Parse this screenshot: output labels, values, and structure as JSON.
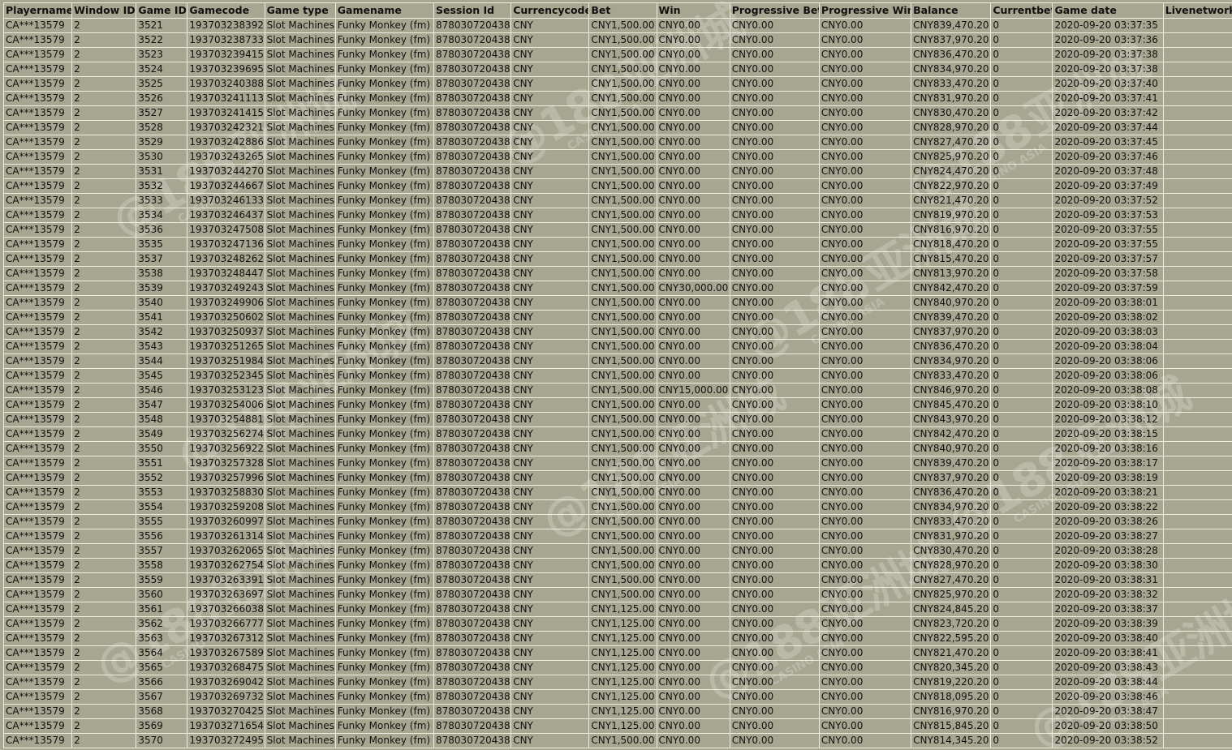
{
  "columns": [
    "Playername",
    "Window ID",
    "Game ID",
    "Gamecode",
    "Game type",
    "Gamename",
    "Session Id",
    "Currencycode",
    "Bet",
    "Win",
    "Progressive Bet",
    "Progressive Win",
    "Balance",
    "Currentbet",
    "Game date",
    "Livenetwork"
  ],
  "rows": [
    [
      "CA***13579",
      "2",
      "3521",
      "193703238392",
      "Slot Machines",
      "Funky Monkey (fm)",
      "878030720438",
      "CNY",
      "CNY1,500.00",
      "CNY0.00",
      "CNY0.00",
      "CNY0.00",
      "CNY839,470.20",
      "0",
      "2020-09-20 03:37:35",
      ""
    ],
    [
      "CA***13579",
      "2",
      "3522",
      "193703238733",
      "Slot Machines",
      "Funky Monkey (fm)",
      "878030720438",
      "CNY",
      "CNY1,500.00",
      "CNY0.00",
      "CNY0.00",
      "CNY0.00",
      "CNY837,970.20",
      "0",
      "2020-09-20 03:37:36",
      ""
    ],
    [
      "CA***13579",
      "2",
      "3523",
      "193703239415",
      "Slot Machines",
      "Funky Monkey (fm)",
      "878030720438",
      "CNY",
      "CNY1,500.00",
      "CNY0.00",
      "CNY0.00",
      "CNY0.00",
      "CNY836,470.20",
      "0",
      "2020-09-20 03:37:38",
      ""
    ],
    [
      "CA***13579",
      "2",
      "3524",
      "193703239695",
      "Slot Machines",
      "Funky Monkey (fm)",
      "878030720438",
      "CNY",
      "CNY1,500.00",
      "CNY0.00",
      "CNY0.00",
      "CNY0.00",
      "CNY834,970.20",
      "0",
      "2020-09-20 03:37:38",
      ""
    ],
    [
      "CA***13579",
      "2",
      "3525",
      "193703240388",
      "Slot Machines",
      "Funky Monkey (fm)",
      "878030720438",
      "CNY",
      "CNY1,500.00",
      "CNY0.00",
      "CNY0.00",
      "CNY0.00",
      "CNY833,470.20",
      "0",
      "2020-09-20 03:37:40",
      ""
    ],
    [
      "CA***13579",
      "2",
      "3526",
      "193703241113",
      "Slot Machines",
      "Funky Monkey (fm)",
      "878030720438",
      "CNY",
      "CNY1,500.00",
      "CNY0.00",
      "CNY0.00",
      "CNY0.00",
      "CNY831,970.20",
      "0",
      "2020-09-20 03:37:41",
      ""
    ],
    [
      "CA***13579",
      "2",
      "3527",
      "193703241415",
      "Slot Machines",
      "Funky Monkey (fm)",
      "878030720438",
      "CNY",
      "CNY1,500.00",
      "CNY0.00",
      "CNY0.00",
      "CNY0.00",
      "CNY830,470.20",
      "0",
      "2020-09-20 03:37:42",
      ""
    ],
    [
      "CA***13579",
      "2",
      "3528",
      "193703242321",
      "Slot Machines",
      "Funky Monkey (fm)",
      "878030720438",
      "CNY",
      "CNY1,500.00",
      "CNY0.00",
      "CNY0.00",
      "CNY0.00",
      "CNY828,970.20",
      "0",
      "2020-09-20 03:37:44",
      ""
    ],
    [
      "CA***13579",
      "2",
      "3529",
      "193703242886",
      "Slot Machines",
      "Funky Monkey (fm)",
      "878030720438",
      "CNY",
      "CNY1,500.00",
      "CNY0.00",
      "CNY0.00",
      "CNY0.00",
      "CNY827,470.20",
      "0",
      "2020-09-20 03:37:45",
      ""
    ],
    [
      "CA***13579",
      "2",
      "3530",
      "193703243265",
      "Slot Machines",
      "Funky Monkey (fm)",
      "878030720438",
      "CNY",
      "CNY1,500.00",
      "CNY0.00",
      "CNY0.00",
      "CNY0.00",
      "CNY825,970.20",
      "0",
      "2020-09-20 03:37:46",
      ""
    ],
    [
      "CA***13579",
      "2",
      "3531",
      "193703244270",
      "Slot Machines",
      "Funky Monkey (fm)",
      "878030720438",
      "CNY",
      "CNY1,500.00",
      "CNY0.00",
      "CNY0.00",
      "CNY0.00",
      "CNY824,470.20",
      "0",
      "2020-09-20 03:37:48",
      ""
    ],
    [
      "CA***13579",
      "2",
      "3532",
      "193703244667",
      "Slot Machines",
      "Funky Monkey (fm)",
      "878030720438",
      "CNY",
      "CNY1,500.00",
      "CNY0.00",
      "CNY0.00",
      "CNY0.00",
      "CNY822,970.20",
      "0",
      "2020-09-20 03:37:49",
      ""
    ],
    [
      "CA***13579",
      "2",
      "3533",
      "193703246133",
      "Slot Machines",
      "Funky Monkey (fm)",
      "878030720438",
      "CNY",
      "CNY1,500.00",
      "CNY0.00",
      "CNY0.00",
      "CNY0.00",
      "CNY821,470.20",
      "0",
      "2020-09-20 03:37:52",
      ""
    ],
    [
      "CA***13579",
      "2",
      "3534",
      "193703246437",
      "Slot Machines",
      "Funky Monkey (fm)",
      "878030720438",
      "CNY",
      "CNY1,500.00",
      "CNY0.00",
      "CNY0.00",
      "CNY0.00",
      "CNY819,970.20",
      "0",
      "2020-09-20 03:37:53",
      ""
    ],
    [
      "CA***13579",
      "2",
      "3536",
      "193703247508",
      "Slot Machines",
      "Funky Monkey (fm)",
      "878030720438",
      "CNY",
      "CNY1,500.00",
      "CNY0.00",
      "CNY0.00",
      "CNY0.00",
      "CNY816,970.20",
      "0",
      "2020-09-20 03:37:55",
      ""
    ],
    [
      "CA***13579",
      "2",
      "3535",
      "193703247136",
      "Slot Machines",
      "Funky Monkey (fm)",
      "878030720438",
      "CNY",
      "CNY1,500.00",
      "CNY0.00",
      "CNY0.00",
      "CNY0.00",
      "CNY818,470.20",
      "0",
      "2020-09-20 03:37:55",
      ""
    ],
    [
      "CA***13579",
      "2",
      "3537",
      "193703248262",
      "Slot Machines",
      "Funky Monkey (fm)",
      "878030720438",
      "CNY",
      "CNY1,500.00",
      "CNY0.00",
      "CNY0.00",
      "CNY0.00",
      "CNY815,470.20",
      "0",
      "2020-09-20 03:37:57",
      ""
    ],
    [
      "CA***13579",
      "2",
      "3538",
      "193703248447",
      "Slot Machines",
      "Funky Monkey (fm)",
      "878030720438",
      "CNY",
      "CNY1,500.00",
      "CNY0.00",
      "CNY0.00",
      "CNY0.00",
      "CNY813,970.20",
      "0",
      "2020-09-20 03:37:58",
      ""
    ],
    [
      "CA***13579",
      "2",
      "3539",
      "193703249243",
      "Slot Machines",
      "Funky Monkey (fm)",
      "878030720438",
      "CNY",
      "CNY1,500.00",
      "CNY30,000.00",
      "CNY0.00",
      "CNY0.00",
      "CNY842,470.20",
      "0",
      "2020-09-20 03:37:59",
      ""
    ],
    [
      "CA***13579",
      "2",
      "3540",
      "193703249906",
      "Slot Machines",
      "Funky Monkey (fm)",
      "878030720438",
      "CNY",
      "CNY1,500.00",
      "CNY0.00",
      "CNY0.00",
      "CNY0.00",
      "CNY840,970.20",
      "0",
      "2020-09-20 03:38:01",
      ""
    ],
    [
      "CA***13579",
      "2",
      "3541",
      "193703250602",
      "Slot Machines",
      "Funky Monkey (fm)",
      "878030720438",
      "CNY",
      "CNY1,500.00",
      "CNY0.00",
      "CNY0.00",
      "CNY0.00",
      "CNY839,470.20",
      "0",
      "2020-09-20 03:38:02",
      ""
    ],
    [
      "CA***13579",
      "2",
      "3542",
      "193703250937",
      "Slot Machines",
      "Funky Monkey (fm)",
      "878030720438",
      "CNY",
      "CNY1,500.00",
      "CNY0.00",
      "CNY0.00",
      "CNY0.00",
      "CNY837,970.20",
      "0",
      "2020-09-20 03:38:03",
      ""
    ],
    [
      "CA***13579",
      "2",
      "3543",
      "193703251265",
      "Slot Machines",
      "Funky Monkey (fm)",
      "878030720438",
      "CNY",
      "CNY1,500.00",
      "CNY0.00",
      "CNY0.00",
      "CNY0.00",
      "CNY836,470.20",
      "0",
      "2020-09-20 03:38:04",
      ""
    ],
    [
      "CA***13579",
      "2",
      "3544",
      "193703251984",
      "Slot Machines",
      "Funky Monkey (fm)",
      "878030720438",
      "CNY",
      "CNY1,500.00",
      "CNY0.00",
      "CNY0.00",
      "CNY0.00",
      "CNY834,970.20",
      "0",
      "2020-09-20 03:38:06",
      ""
    ],
    [
      "CA***13579",
      "2",
      "3545",
      "193703252345",
      "Slot Machines",
      "Funky Monkey (fm)",
      "878030720438",
      "CNY",
      "CNY1,500.00",
      "CNY0.00",
      "CNY0.00",
      "CNY0.00",
      "CNY833,470.20",
      "0",
      "2020-09-20 03:38:06",
      ""
    ],
    [
      "CA***13579",
      "2",
      "3546",
      "193703253123",
      "Slot Machines",
      "Funky Monkey (fm)",
      "878030720438",
      "CNY",
      "CNY1,500.00",
      "CNY15,000.00",
      "CNY0.00",
      "CNY0.00",
      "CNY846,970.20",
      "0",
      "2020-09-20 03:38:08",
      ""
    ],
    [
      "CA***13579",
      "2",
      "3547",
      "193703254006",
      "Slot Machines",
      "Funky Monkey (fm)",
      "878030720438",
      "CNY",
      "CNY1,500.00",
      "CNY0.00",
      "CNY0.00",
      "CNY0.00",
      "CNY845,470.20",
      "0",
      "2020-09-20 03:38:10",
      ""
    ],
    [
      "CA***13579",
      "2",
      "3548",
      "193703254881",
      "Slot Machines",
      "Funky Monkey (fm)",
      "878030720438",
      "CNY",
      "CNY1,500.00",
      "CNY0.00",
      "CNY0.00",
      "CNY0.00",
      "CNY843,970.20",
      "0",
      "2020-09-20 03:38:12",
      ""
    ],
    [
      "CA***13579",
      "2",
      "3549",
      "193703256274",
      "Slot Machines",
      "Funky Monkey (fm)",
      "878030720438",
      "CNY",
      "CNY1,500.00",
      "CNY0.00",
      "CNY0.00",
      "CNY0.00",
      "CNY842,470.20",
      "0",
      "2020-09-20 03:38:15",
      ""
    ],
    [
      "CA***13579",
      "2",
      "3550",
      "193703256922",
      "Slot Machines",
      "Funky Monkey (fm)",
      "878030720438",
      "CNY",
      "CNY1,500.00",
      "CNY0.00",
      "CNY0.00",
      "CNY0.00",
      "CNY840,970.20",
      "0",
      "2020-09-20 03:38:16",
      ""
    ],
    [
      "CA***13579",
      "2",
      "3551",
      "193703257328",
      "Slot Machines",
      "Funky Monkey (fm)",
      "878030720438",
      "CNY",
      "CNY1,500.00",
      "CNY0.00",
      "CNY0.00",
      "CNY0.00",
      "CNY839,470.20",
      "0",
      "2020-09-20 03:38:17",
      ""
    ],
    [
      "CA***13579",
      "2",
      "3552",
      "193703257996",
      "Slot Machines",
      "Funky Monkey (fm)",
      "878030720438",
      "CNY",
      "CNY1,500.00",
      "CNY0.00",
      "CNY0.00",
      "CNY0.00",
      "CNY837,970.20",
      "0",
      "2020-09-20 03:38:19",
      ""
    ],
    [
      "CA***13579",
      "2",
      "3553",
      "193703258830",
      "Slot Machines",
      "Funky Monkey (fm)",
      "878030720438",
      "CNY",
      "CNY1,500.00",
      "CNY0.00",
      "CNY0.00",
      "CNY0.00",
      "CNY836,470.20",
      "0",
      "2020-09-20 03:38:21",
      ""
    ],
    [
      "CA***13579",
      "2",
      "3554",
      "193703259208",
      "Slot Machines",
      "Funky Monkey (fm)",
      "878030720438",
      "CNY",
      "CNY1,500.00",
      "CNY0.00",
      "CNY0.00",
      "CNY0.00",
      "CNY834,970.20",
      "0",
      "2020-09-20 03:38:22",
      ""
    ],
    [
      "CA***13579",
      "2",
      "3555",
      "193703260997",
      "Slot Machines",
      "Funky Monkey (fm)",
      "878030720438",
      "CNY",
      "CNY1,500.00",
      "CNY0.00",
      "CNY0.00",
      "CNY0.00",
      "CNY833,470.20",
      "0",
      "2020-09-20 03:38:26",
      ""
    ],
    [
      "CA***13579",
      "2",
      "3556",
      "193703261314",
      "Slot Machines",
      "Funky Monkey (fm)",
      "878030720438",
      "CNY",
      "CNY1,500.00",
      "CNY0.00",
      "CNY0.00",
      "CNY0.00",
      "CNY831,970.20",
      "0",
      "2020-09-20 03:38:27",
      ""
    ],
    [
      "CA***13579",
      "2",
      "3557",
      "193703262065",
      "Slot Machines",
      "Funky Monkey (fm)",
      "878030720438",
      "CNY",
      "CNY1,500.00",
      "CNY0.00",
      "CNY0.00",
      "CNY0.00",
      "CNY830,470.20",
      "0",
      "2020-09-20 03:38:28",
      ""
    ],
    [
      "CA***13579",
      "2",
      "3558",
      "193703262754",
      "Slot Machines",
      "Funky Monkey (fm)",
      "878030720438",
      "CNY",
      "CNY1,500.00",
      "CNY0.00",
      "CNY0.00",
      "CNY0.00",
      "CNY828,970.20",
      "0",
      "2020-09-20 03:38:30",
      ""
    ],
    [
      "CA***13579",
      "2",
      "3559",
      "193703263391",
      "Slot Machines",
      "Funky Monkey (fm)",
      "878030720438",
      "CNY",
      "CNY1,500.00",
      "CNY0.00",
      "CNY0.00",
      "CNY0.00",
      "CNY827,470.20",
      "0",
      "2020-09-20 03:38:31",
      ""
    ],
    [
      "CA***13579",
      "2",
      "3560",
      "193703263697",
      "Slot Machines",
      "Funky Monkey (fm)",
      "878030720438",
      "CNY",
      "CNY1,500.00",
      "CNY0.00",
      "CNY0.00",
      "CNY0.00",
      "CNY825,970.20",
      "0",
      "2020-09-20 03:38:32",
      ""
    ],
    [
      "CA***13579",
      "2",
      "3561",
      "193703266038",
      "Slot Machines",
      "Funky Monkey (fm)",
      "878030720438",
      "CNY",
      "CNY1,125.00",
      "CNY0.00",
      "CNY0.00",
      "CNY0.00",
      "CNY824,845.20",
      "0",
      "2020-09-20 03:38:37",
      ""
    ],
    [
      "CA***13579",
      "2",
      "3562",
      "193703266777",
      "Slot Machines",
      "Funky Monkey (fm)",
      "878030720438",
      "CNY",
      "CNY1,125.00",
      "CNY0.00",
      "CNY0.00",
      "CNY0.00",
      "CNY823,720.20",
      "0",
      "2020-09-20 03:38:39",
      ""
    ],
    [
      "CA***13579",
      "2",
      "3563",
      "193703267312",
      "Slot Machines",
      "Funky Monkey (fm)",
      "878030720438",
      "CNY",
      "CNY1,125.00",
      "CNY0.00",
      "CNY0.00",
      "CNY0.00",
      "CNY822,595.20",
      "0",
      "2020-09-20 03:38:40",
      ""
    ],
    [
      "CA***13579",
      "2",
      "3564",
      "193703267589",
      "Slot Machines",
      "Funky Monkey (fm)",
      "878030720438",
      "CNY",
      "CNY1,125.00",
      "CNY0.00",
      "CNY0.00",
      "CNY0.00",
      "CNY821,470.20",
      "0",
      "2020-09-20 03:38:41",
      ""
    ],
    [
      "CA***13579",
      "2",
      "3565",
      "193703268475",
      "Slot Machines",
      "Funky Monkey (fm)",
      "878030720438",
      "CNY",
      "CNY1,125.00",
      "CNY0.00",
      "CNY0.00",
      "CNY0.00",
      "CNY820,345.20",
      "0",
      "2020-09-20 03:38:43",
      ""
    ],
    [
      "CA***13579",
      "2",
      "3566",
      "193703269042",
      "Slot Machines",
      "Funky Monkey (fm)",
      "878030720438",
      "CNY",
      "CNY1,125.00",
      "CNY0.00",
      "CNY0.00",
      "CNY0.00",
      "CNY819,220.20",
      "0",
      "2020-09-20 03:38:44",
      ""
    ],
    [
      "CA***13579",
      "2",
      "3567",
      "193703269732",
      "Slot Machines",
      "Funky Monkey (fm)",
      "878030720438",
      "CNY",
      "CNY1,125.00",
      "CNY0.00",
      "CNY0.00",
      "CNY0.00",
      "CNY818,095.20",
      "0",
      "2020-09-20 03:38:46",
      ""
    ],
    [
      "CA***13579",
      "2",
      "3568",
      "193703270425",
      "Slot Machines",
      "Funky Monkey (fm)",
      "878030720438",
      "CNY",
      "CNY1,125.00",
      "CNY0.00",
      "CNY0.00",
      "CNY0.00",
      "CNY816,970.20",
      "0",
      "2020-09-20 03:38:47",
      ""
    ],
    [
      "CA***13579",
      "2",
      "3569",
      "193703271654",
      "Slot Machines",
      "Funky Monkey (fm)",
      "878030720438",
      "CNY",
      "CNY1,125.00",
      "CNY0.00",
      "CNY0.00",
      "CNY0.00",
      "CNY815,845.20",
      "0",
      "2020-09-20 03:38:50",
      ""
    ],
    [
      "CA***13579",
      "2",
      "3570",
      "193703272495",
      "Slot Machines",
      "Funky Monkey (fm)",
      "878030720438",
      "CNY",
      "CNY1,500.00",
      "CNY0.00",
      "CNY0.00",
      "CNY0.00",
      "CNY814,345.20",
      "0",
      "2020-09-20 03:38:52",
      ""
    ]
  ],
  "watermark": {
    "logo_text": "@188",
    "cn_text": "亚洲城",
    "en_text": "CASINO ASIA"
  },
  "colors": {
    "background": "#a7a690",
    "grid": "#efeedf",
    "text": "#111111"
  }
}
